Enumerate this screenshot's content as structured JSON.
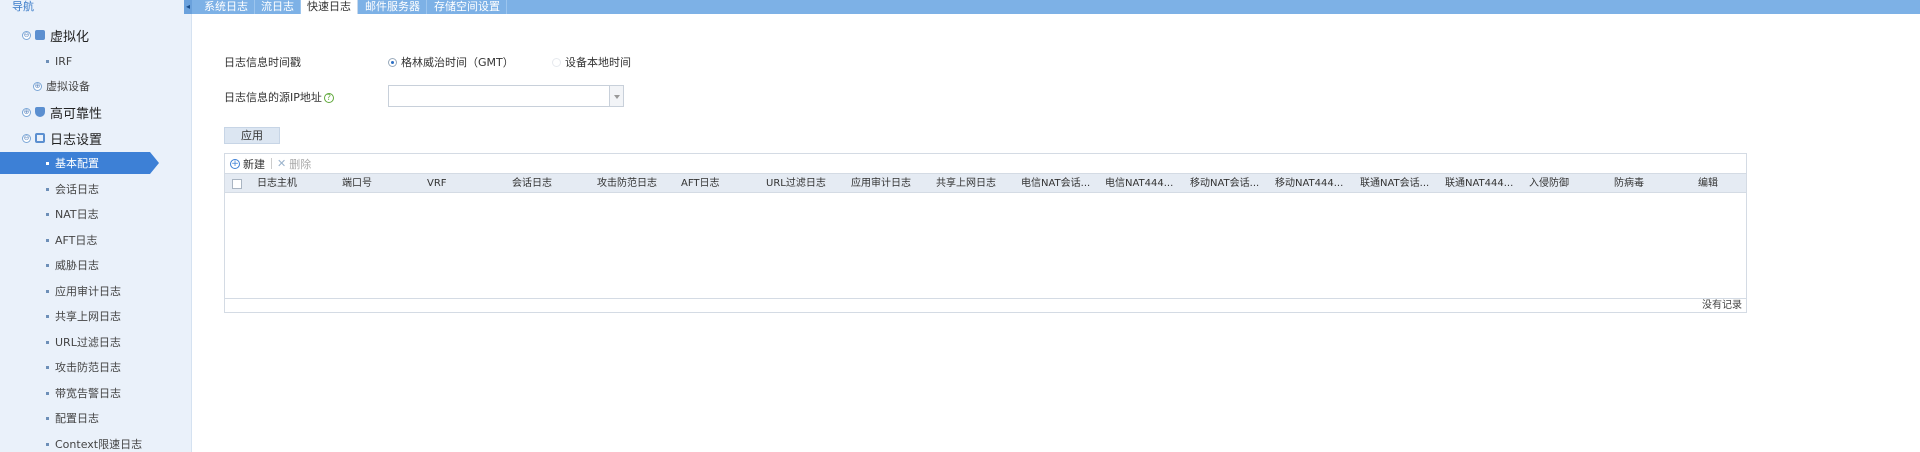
{
  "sidebar": {
    "title": "导航",
    "items": [
      {
        "label": "虚拟化",
        "level": 1,
        "toggle": "⊖",
        "icon": "folder-icon"
      },
      {
        "label": "IRF",
        "level": 2
      },
      {
        "label": "虚拟设备",
        "level": "1b",
        "toggle": "⊕"
      },
      {
        "label": "高可靠性",
        "level": 1,
        "toggle": "⊕",
        "icon": "shield-icon"
      },
      {
        "label": "日志设置",
        "level": 1,
        "toggle": "⊖",
        "icon": "document-icon"
      },
      {
        "label": "基本配置",
        "level": 2,
        "active": true
      },
      {
        "label": "会话日志",
        "level": 2
      },
      {
        "label": "NAT日志",
        "level": 2
      },
      {
        "label": "AFT日志",
        "level": 2
      },
      {
        "label": "威胁日志",
        "level": 2
      },
      {
        "label": "应用审计日志",
        "level": 2
      },
      {
        "label": "共享上网日志",
        "level": 2
      },
      {
        "label": "URL过滤日志",
        "level": 2
      },
      {
        "label": "攻击防范日志",
        "level": 2
      },
      {
        "label": "带宽告警日志",
        "level": 2
      },
      {
        "label": "配置日志",
        "level": 2
      },
      {
        "label": "Context限速日志",
        "level": 2
      }
    ]
  },
  "tabs": [
    {
      "label": "系统日志"
    },
    {
      "label": "流日志"
    },
    {
      "label": "快速日志",
      "active": true
    },
    {
      "label": "邮件服务器"
    },
    {
      "label": "存储空间设置"
    }
  ],
  "form": {
    "timestamp_label": "日志信息时间戳",
    "radio_gmt": "格林威治时间（GMT）",
    "radio_local": "设备本地时间",
    "source_ip_label": "日志信息的源IP地址",
    "source_ip_value": "",
    "apply_label": "应用"
  },
  "toolbar": {
    "add_label": "新建",
    "delete_label": "删除"
  },
  "table": {
    "columns": [
      "日志主机",
      "端口号",
      "VRF",
      "会话日志",
      "攻击防范日志",
      "AFT日志",
      "URL过滤日志",
      "应用审计日志",
      "共享上网日志",
      "电信NAT会话...",
      "电信NAT444...",
      "移动NAT会话...",
      "移动NAT444...",
      "联通NAT会话...",
      "联通NAT444...",
      "入侵防御",
      "防病毒",
      "编辑"
    ],
    "rows": [],
    "empty_text": "没有记录"
  },
  "colors": {
    "accent": "#3d80d6",
    "tabbar": "#7db1e6",
    "sidebar_bg": "#eaf1fa"
  }
}
